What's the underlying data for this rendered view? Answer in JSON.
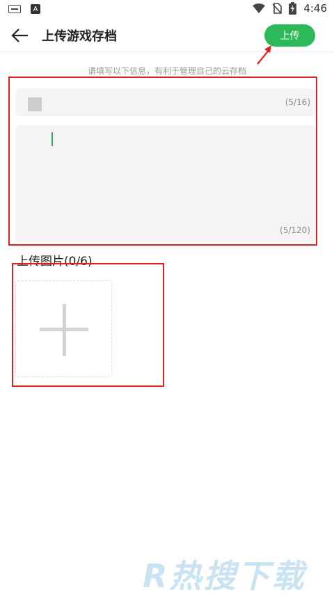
{
  "status_bar": {
    "time": "4:46"
  },
  "header": {
    "title": "上传游戏存档",
    "upload_label": "上传"
  },
  "form": {
    "hint": "请填写以下信息，有利于管理自己的云存档",
    "name_field": {
      "counter": "(5/16)"
    },
    "description_field": {
      "counter": "(5/120)"
    },
    "images": {
      "label": "上传图片(0/6)"
    }
  },
  "watermark": {
    "text": "R热搜下载"
  },
  "annotations": {
    "highlight_color": "#e02020",
    "accent": "#2db85a"
  }
}
